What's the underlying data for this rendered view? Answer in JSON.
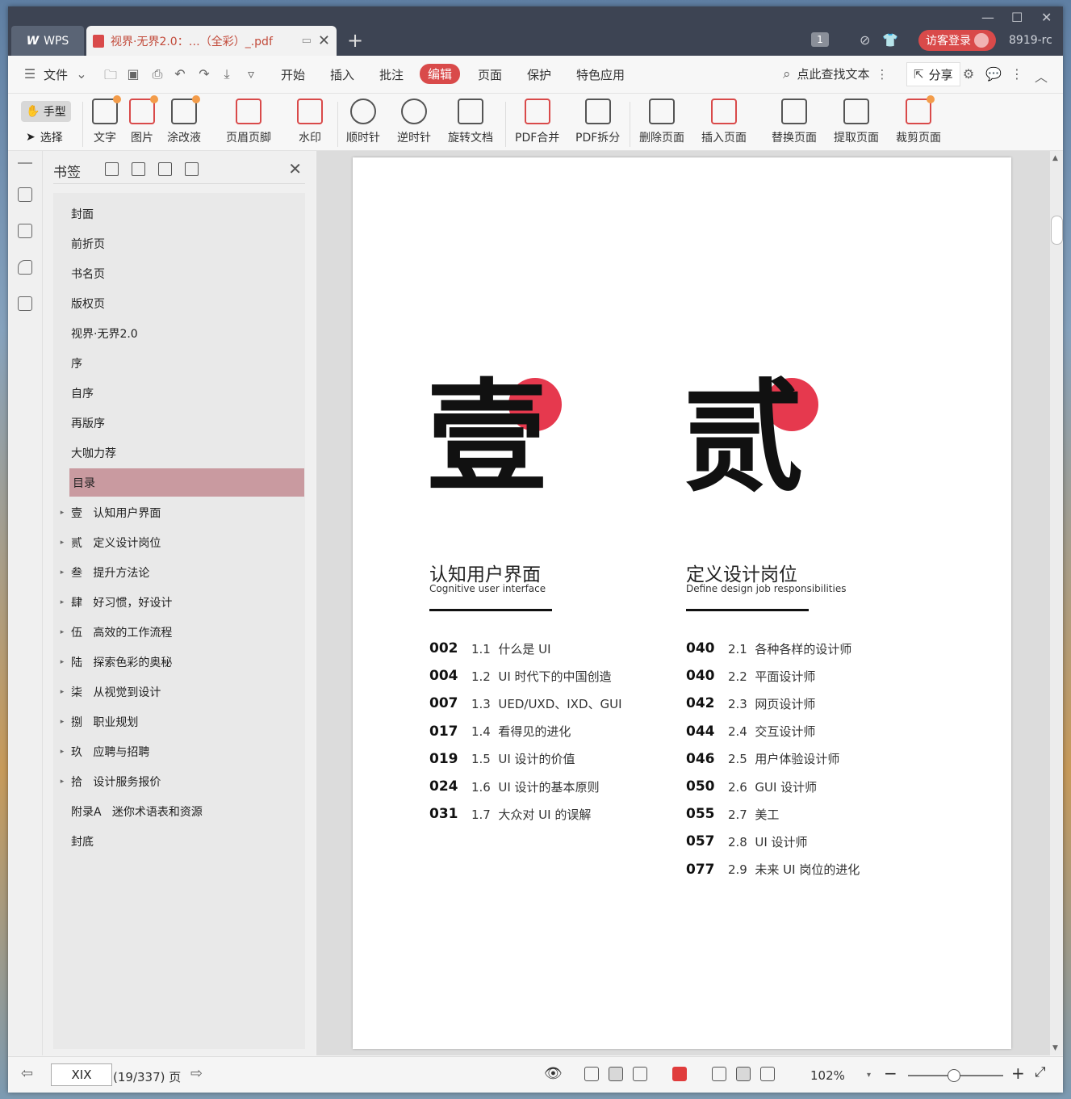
{
  "titlebar": {
    "app_tab": "WPS",
    "doc_tab": "视界·无界2.0：…（全彩）_.pdf",
    "user_count": "1",
    "login": "访客登录",
    "version": "8919-rc"
  },
  "menu": {
    "file": "文件",
    "items": [
      "开始",
      "插入",
      "批注",
      "编辑",
      "页面",
      "保护",
      "特色应用"
    ],
    "active": "编辑",
    "search": "点此查找文本",
    "share": "分享"
  },
  "ribbon": {
    "hand": "手型",
    "select": "选择",
    "buttons": [
      "文字",
      "图片",
      "涂改液",
      "页眉页脚",
      "水印",
      "顺时针",
      "逆时针",
      "旋转文档",
      "PDF合并",
      "PDF拆分",
      "删除页面",
      "插入页面",
      "替换页面",
      "提取页面",
      "裁剪页面"
    ]
  },
  "bookmarks": {
    "title": "书签",
    "items": [
      {
        "label": "封面",
        "expandable": false
      },
      {
        "label": "前折页",
        "expandable": false
      },
      {
        "label": "书名页",
        "expandable": false
      },
      {
        "label": "版权页",
        "expandable": false
      },
      {
        "label": "视界·无界2.0",
        "expandable": false
      },
      {
        "label": "序",
        "expandable": false
      },
      {
        "label": "自序",
        "expandable": false
      },
      {
        "label": "再版序",
        "expandable": false
      },
      {
        "label": "大咖力荐",
        "expandable": false
      },
      {
        "label": "目录",
        "expandable": false,
        "selected": true
      },
      {
        "label": "壹   认知用户界面",
        "expandable": true
      },
      {
        "label": "贰   定义设计岗位",
        "expandable": true
      },
      {
        "label": "叁   提升方法论",
        "expandable": true
      },
      {
        "label": "肆   好习惯，好设计",
        "expandable": true
      },
      {
        "label": "伍   高效的工作流程",
        "expandable": true
      },
      {
        "label": "陆   探索色彩的奥秘",
        "expandable": true
      },
      {
        "label": "柒   从视觉到设计",
        "expandable": true
      },
      {
        "label": "捌   职业规划",
        "expandable": true
      },
      {
        "label": "玖   应聘与招聘",
        "expandable": true
      },
      {
        "label": "拾   设计服务报价",
        "expandable": true
      },
      {
        "label": "附录A   迷你术语表和资源",
        "expandable": false
      },
      {
        "label": "封底",
        "expandable": false
      }
    ]
  },
  "page": {
    "sections": [
      {
        "char": "壹",
        "title": "认知用户界面",
        "subtitle": "Cognitive user interface",
        "entries": [
          {
            "page": "002",
            "text": "1.1  什么是 UI"
          },
          {
            "page": "004",
            "text": "1.2  UI 时代下的中国创造"
          },
          {
            "page": "007",
            "text": "1.3  UED/UXD、IXD、GUI"
          },
          {
            "page": "017",
            "text": "1.4  看得见的进化"
          },
          {
            "page": "019",
            "text": "1.5  UI 设计的价值"
          },
          {
            "page": "024",
            "text": "1.6  UI 设计的基本原则"
          },
          {
            "page": "031",
            "text": "1.7  大众对 UI 的误解"
          }
        ]
      },
      {
        "char": "贰",
        "title": "定义设计岗位",
        "subtitle": "Define design job responsibilities",
        "entries": [
          {
            "page": "040",
            "text": "2.1  各种各样的设计师"
          },
          {
            "page": "040",
            "text": "2.2  平面设计师"
          },
          {
            "page": "042",
            "text": "2.3  网页设计师"
          },
          {
            "page": "044",
            "text": "2.4  交互设计师"
          },
          {
            "page": "046",
            "text": "2.5  用户体验设计师"
          },
          {
            "page": "050",
            "text": "2.6  GUI 设计师"
          },
          {
            "page": "055",
            "text": "2.7  美工"
          },
          {
            "page": "057",
            "text": "2.8  UI 设计师"
          },
          {
            "page": "077",
            "text": "2.9  未来 UI 岗位的进化"
          }
        ]
      }
    ],
    "accent_color": "#e6394e"
  },
  "status": {
    "page_input": "XIX",
    "page_info": "(19/337) 页",
    "zoom": "102%"
  }
}
